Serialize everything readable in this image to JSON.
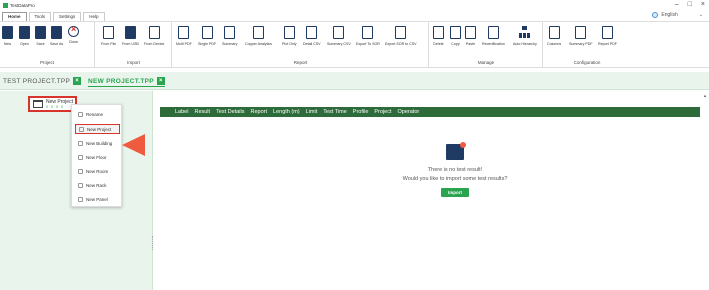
{
  "window": {
    "title": "TestDataPro",
    "controls": [
      "–",
      "□",
      "×"
    ]
  },
  "menu": {
    "tabs": [
      "Home",
      "Tools",
      "Settings",
      "Help"
    ],
    "active": "Home"
  },
  "language": {
    "label": "English",
    "chevron": "⌄"
  },
  "ribbon": {
    "project": {
      "label": "Project",
      "buttons": [
        "New",
        "Open",
        "Save",
        "Save As",
        "Close"
      ]
    },
    "import": {
      "label": "Import",
      "buttons": [
        "From File",
        "From USB",
        "From Device"
      ]
    },
    "report": {
      "label": "Report",
      "buttons": [
        "Multi PDF",
        "Single PDF",
        "Summary",
        "Copper Analytics",
        "Plot Only",
        "Detail CSV",
        "Summary CSV",
        "Export To SOR",
        "Export SOR to CSV"
      ]
    },
    "manage": {
      "label": "Manage",
      "buttons": [
        "Delete",
        "Copy",
        "Paste",
        "Recertification",
        "Auto Hierarchy"
      ]
    },
    "configuration": {
      "label": "Configuration",
      "buttons": [
        "Columns",
        "Summary PDF",
        "Report PDF"
      ]
    }
  },
  "project_tabs": [
    {
      "label": "TEST PROJECT.TPP",
      "close": "×"
    },
    {
      "label": "NEW PROJECT.TPP",
      "close": "×"
    }
  ],
  "tree": {
    "node_label": "New Project",
    "node_counts": "0 · 0 · 0 · 0"
  },
  "context_menu": {
    "items": [
      "Rename",
      "New Project",
      "New Building",
      "New Floor",
      "New Room",
      "New Rack",
      "New Panel"
    ],
    "highlighted": "New Project"
  },
  "table": {
    "columns": [
      "Label",
      "Result",
      "Test Details",
      "Report",
      "Length (m)",
      "Limit",
      "Test Time",
      "Profile",
      "Project",
      "Operator"
    ]
  },
  "empty_state": {
    "line1": "There is no test result!",
    "line2": "Would you like to import some test results?",
    "button": "Import"
  },
  "colors": {
    "accent": "#2aa44f",
    "header": "#2e6b3a",
    "highlight": "#d9342b",
    "arrow": "#ef5b3f",
    "icon": "#1f3b63"
  }
}
